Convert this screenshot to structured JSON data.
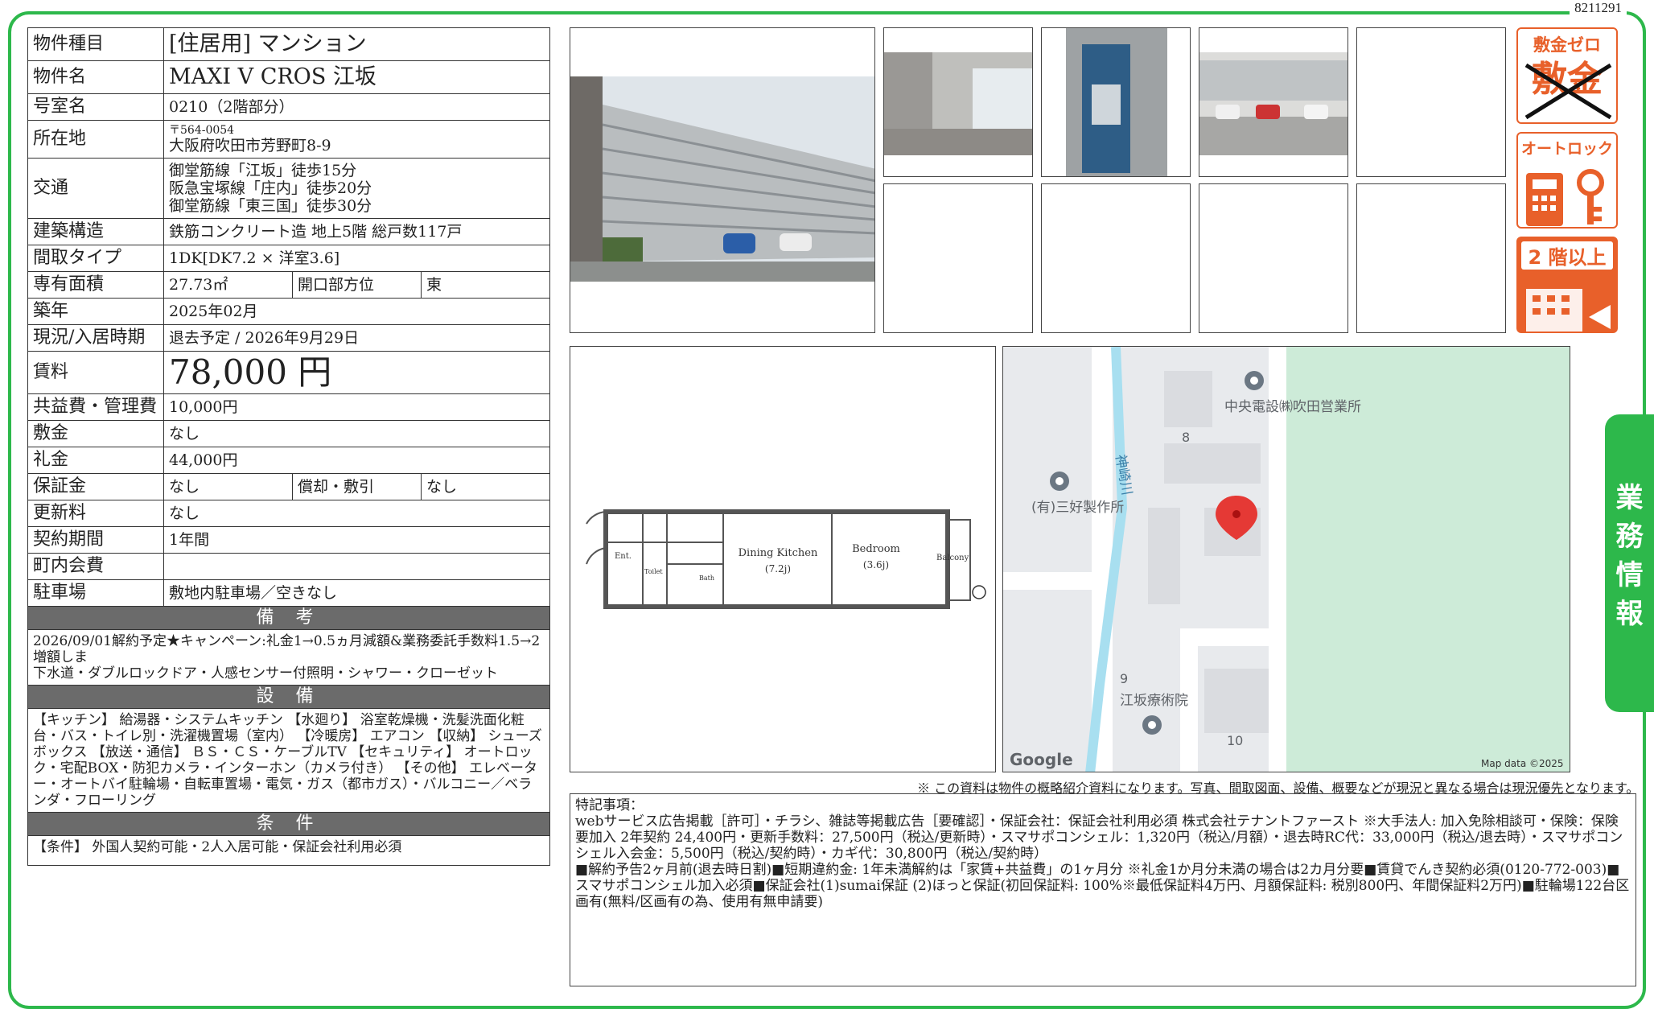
{
  "property_id": "8211291",
  "spec": {
    "type_label": "物件種目",
    "type_value": "[住居用] マンション",
    "name_label": "物件名",
    "name_value": "MAXI V CROS 江坂",
    "room_label": "号室名",
    "room_value": "0210（2階部分）",
    "addr_label": "所在地",
    "addr_postal": "〒564-0054",
    "addr_value": "大阪府吹田市芳野町8-9",
    "access_label": "交通",
    "access_1": "御堂筋線「江坂」徒歩15分",
    "access_2": "阪急宝塚線「庄内」徒歩20分",
    "access_3": "御堂筋線「東三国」徒歩30分",
    "structure_label": "建築構造",
    "structure_value": "鉄筋コンクリート造 地上5階 総戸数117戸",
    "layout_label": "間取タイプ",
    "layout_value": "1DK[DK7.2 × 洋室3.6]",
    "area_label": "専有面積",
    "area_value": "27.73㎡",
    "facing_label": "開口部方位",
    "facing_value": "東",
    "built_label": "築年",
    "built_value": "2025年02月",
    "status_label": "現況/入居時期",
    "status_value": "退去予定 / 2026年9月29日",
    "rent_label": "賃料",
    "rent_value": "78,000 円",
    "fee_label": "共益費・管理費",
    "fee_value": "10,000円",
    "deposit_label": "敷金",
    "deposit_value": "なし",
    "keymoney_label": "礼金",
    "keymoney_value": "44,000円",
    "guarantee_label": "保証金",
    "guarantee_value": "なし",
    "amort_label": "償却・敷引",
    "amort_value": "なし",
    "renewal_label": "更新料",
    "renewal_value": "なし",
    "contract_label": "契約期間",
    "contract_value": "1年間",
    "assoc_label": "町内会費",
    "assoc_value": "",
    "parking_label": "駐車場",
    "parking_value": "敷地内駐車場／空きなし"
  },
  "remarks_head": "備 考",
  "remarks_text": "2026/09/01解約予定★キャンペーン:礼金1→0.5ヵ月減額&業務委託手数料1.5→2増額しま\n下水道・ダブルロックドア・人感センサー付照明・シャワー・クローゼット",
  "equip_head": "設 備",
  "equip_text": "【キッチン】 給湯器・システムキッチン 【水廻り】 浴室乾燥機・洗髪洗面化粧台・バス・トイレ別・洗濯機置場（室内） 【冷暖房】 エアコン 【収納】 シューズボックス 【放送・通信】 ＢＳ・ＣＳ・ケーブルTV 【セキュリティ】 オートロック・宅配BOX・防犯カメラ・インターホン（カメラ付き） 【その他】 エレベーター・オートバイ駐輪場・自転車置場・電気・ガス（都市ガス）・バルコニー／ベランダ・フローリング",
  "cond_head": "条 件",
  "cond_text": "【条件】 外国人契約可能・2人入居可能・保証会社利用必須",
  "badges": {
    "zero_deposit_1": "敷金ゼロ",
    "zero_deposit_2": "敷金",
    "autolock": "オートロック",
    "floor2": "2 階以上"
  },
  "floorplan": {
    "dk": "Dining Kitchen",
    "dk_size": "(7.2j)",
    "bed": "Bedroom",
    "bed_size": "(3.6j)",
    "balcony": "Balcony",
    "ent": "Ent.",
    "toilet": "Toilet",
    "bath": "Bath"
  },
  "map": {
    "label_1": "中央電設㈱吹田営業所",
    "label_2": "(有)三好製作所",
    "label_3": "江坂療術院",
    "river": "神崎川",
    "n8": "8",
    "n9": "9",
    "n10": "10",
    "google": "Google",
    "copyright": "Map data ©2025"
  },
  "disclaimer": "※ この資料は物件の概略紹介資料になります。写真、間取図面、設備、概要などが現況と異なる場合は現況優先となります。",
  "special_title": "特記事項：",
  "special_text_1": "webサービス広告掲載［許可］・チラシ、雑誌等掲載広告［要確認］・保証会社：保証会社利用必須 株式会社テナントファースト ※大手法人: 加入免除相談可・保険：保険要加入 2年契約 24,400円・更新手数料：27,500円（税込/更新時）・スマサポコンシェル：1,320円（税込/月額）・退去時RC代：33,000円（税込/退去時）・スマサポコンシェル入会金：5,500円（税込/契約時）・カギ代：30,800円（税込/契約時）",
  "special_text_2": "■解約予告2ヶ月前(退去時日割)■短期違約金: 1年未満解約は「家賃+共益費」の1ヶ月分 ※礼金1か月分未満の場合は2カ月分要■賃貸でんき契約必須(0120-772-003)■スマサポコンシェル加入必須■保証会社(1)sumai保証 (2)ほっと保証(初回保証料: 100%※最低保証料4万円、月額保証料: 税別800円、年間保証料2万円)■駐輪場122台区画有(無料/区画有の為、使用有無申請要)",
  "side_tab": "業務情報"
}
